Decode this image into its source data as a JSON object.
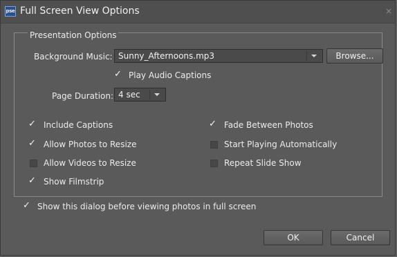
{
  "window": {
    "app_icon": "pse",
    "title": "Full Screen View Options",
    "close_glyph": "×"
  },
  "presentation": {
    "legend": "Presentation Options",
    "background_music_label": "Background Music:",
    "background_music_value": "Sunny_Afternoons.mp3",
    "browse_label": "Browse...",
    "play_audio_captions_label": "Play Audio Captions",
    "play_audio_captions_checked": true,
    "page_duration_label": "Page Duration:",
    "page_duration_value": "4 sec",
    "options": {
      "include_captions": {
        "label": "Include Captions",
        "checked": true
      },
      "allow_photos_resize": {
        "label": "Allow Photos to Resize",
        "checked": true
      },
      "allow_videos_resize": {
        "label": "Allow Videos to Resize",
        "checked": false
      },
      "show_filmstrip": {
        "label": "Show Filmstrip",
        "checked": true
      },
      "fade_between_photos": {
        "label": "Fade Between Photos",
        "checked": true
      },
      "start_playing_automatically": {
        "label": "Start Playing Automatically",
        "checked": false
      },
      "repeat_slide_show": {
        "label": "Repeat Slide Show",
        "checked": false
      }
    }
  },
  "footer": {
    "show_dialog_label": "Show this dialog before viewing photos in full screen",
    "show_dialog_checked": true,
    "ok_label": "OK",
    "cancel_label": "Cancel"
  },
  "icons": {
    "checkbox_checked": "check-icon",
    "dropdown": "chevron-down-icon"
  },
  "colors": {
    "background": "#5a5a5a",
    "text": "#ececec",
    "field": "#4a4a4a"
  }
}
